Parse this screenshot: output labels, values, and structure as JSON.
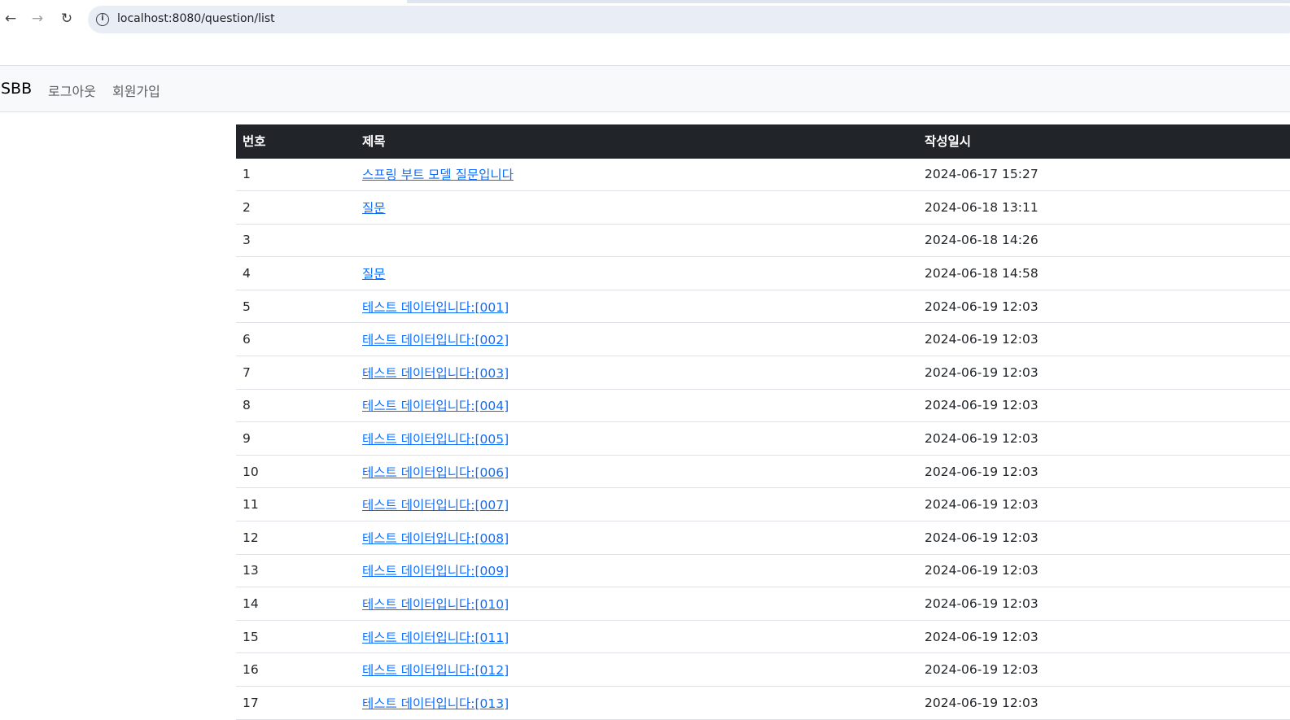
{
  "browser": {
    "url": "localhost:8080/question/list",
    "back_icon": "←",
    "forward_icon": "→",
    "reload_icon": "↻",
    "info_icon": "i"
  },
  "navbar": {
    "brand": "SBB",
    "links": [
      "로그아웃",
      "회원가입"
    ]
  },
  "table": {
    "headers": [
      "번호",
      "제목",
      "작성일시"
    ],
    "rows": [
      {
        "num": "1",
        "subject": "스프링 부트 모델 질문입니다",
        "date": "2024-06-17 15:27"
      },
      {
        "num": "2",
        "subject": "질문",
        "date": "2024-06-18 13:11"
      },
      {
        "num": "3",
        "subject": "",
        "date": "2024-06-18 14:26"
      },
      {
        "num": "4",
        "subject": "질문",
        "date": "2024-06-18 14:58"
      },
      {
        "num": "5",
        "subject": "테스트 데이터입니다:[001]",
        "date": "2024-06-19 12:03"
      },
      {
        "num": "6",
        "subject": "테스트 데이터입니다:[002]",
        "date": "2024-06-19 12:03"
      },
      {
        "num": "7",
        "subject": "테스트 데이터입니다:[003]",
        "date": "2024-06-19 12:03"
      },
      {
        "num": "8",
        "subject": "테스트 데이터입니다:[004]",
        "date": "2024-06-19 12:03"
      },
      {
        "num": "9",
        "subject": "테스트 데이터입니다:[005]",
        "date": "2024-06-19 12:03"
      },
      {
        "num": "10",
        "subject": "테스트 데이터입니다:[006]",
        "date": "2024-06-19 12:03"
      },
      {
        "num": "11",
        "subject": "테스트 데이터입니다:[007]",
        "date": "2024-06-19 12:03"
      },
      {
        "num": "12",
        "subject": "테스트 데이터입니다:[008]",
        "date": "2024-06-19 12:03"
      },
      {
        "num": "13",
        "subject": "테스트 데이터입니다:[009]",
        "date": "2024-06-19 12:03"
      },
      {
        "num": "14",
        "subject": "테스트 데이터입니다:[010]",
        "date": "2024-06-19 12:03"
      },
      {
        "num": "15",
        "subject": "테스트 데이터입니다:[011]",
        "date": "2024-06-19 12:03"
      },
      {
        "num": "16",
        "subject": "테스트 데이터입니다:[012]",
        "date": "2024-06-19 12:03"
      },
      {
        "num": "17",
        "subject": "테스트 데이터입니다:[013]",
        "date": "2024-06-19 12:03"
      }
    ]
  }
}
